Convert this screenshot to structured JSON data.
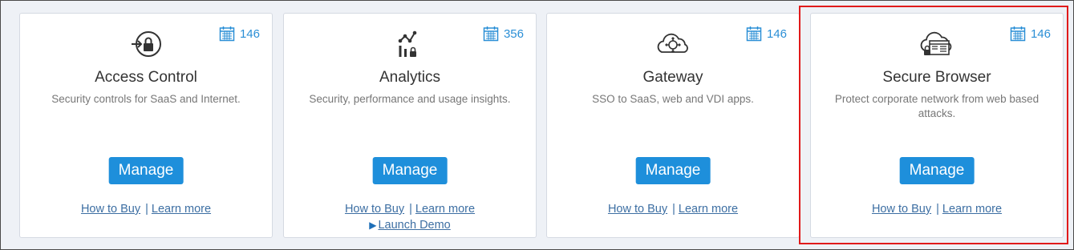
{
  "cards": [
    {
      "title": "Access Control",
      "description": "Security controls for SaaS and Internet.",
      "badge_icon": "calendar-icon",
      "badge_count": "146",
      "icon": "lock-arrow-icon",
      "manage_label": "Manage",
      "how_to_buy": "How to Buy",
      "separator": "|",
      "learn_more": "Learn more"
    },
    {
      "title": "Analytics",
      "description": "Security, performance and usage insights.",
      "badge_icon": "calendar-icon",
      "badge_count": "356",
      "icon": "analytics-chart-icon",
      "manage_label": "Manage",
      "how_to_buy": "How to Buy",
      "separator": "|",
      "learn_more": "Learn more",
      "launch_demo": "Launch Demo"
    },
    {
      "title": "Gateway",
      "description": "SSO to SaaS, web and VDI apps.",
      "badge_icon": "calendar-icon",
      "badge_count": "146",
      "icon": "cloud-gateway-icon",
      "manage_label": "Manage",
      "how_to_buy": "How to Buy",
      "separator": "|",
      "learn_more": "Learn more"
    },
    {
      "title": "Secure Browser",
      "description": "Protect corporate network from web based attacks.",
      "badge_icon": "calendar-icon",
      "badge_count": "146",
      "icon": "cloud-browser-icon",
      "manage_label": "Manage",
      "how_to_buy": "How to Buy",
      "separator": "|",
      "learn_more": "Learn more"
    }
  ],
  "colors": {
    "accent": "#1e8fdb",
    "badge": "#2b8fd6",
    "link": "#3d6fa3",
    "highlight": "#e01b1b",
    "background": "#eef1f6"
  }
}
